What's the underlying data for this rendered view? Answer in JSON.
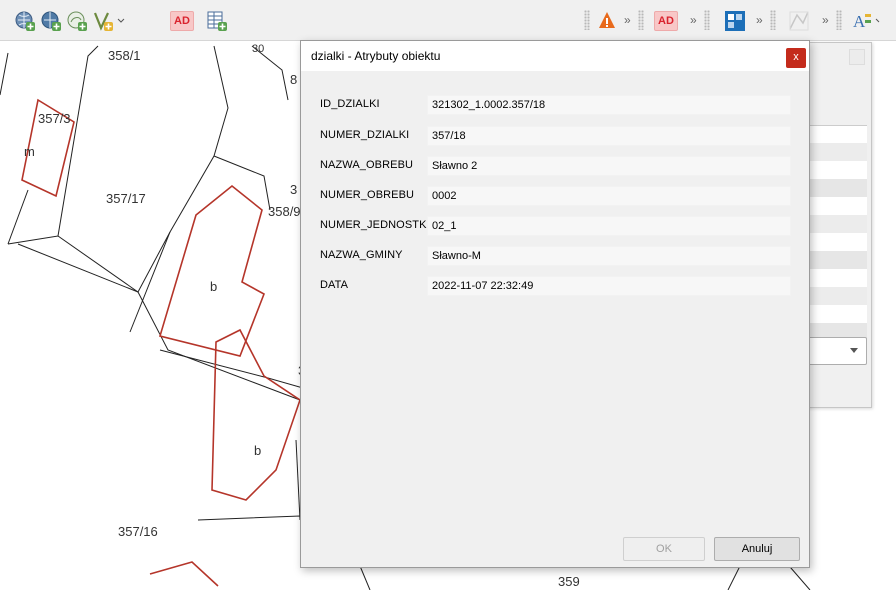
{
  "toolbar": {
    "left_icons": [
      "add-wms-icon",
      "add-wfs-icon",
      "add-wcs-icon",
      "add-vector-layer-icon",
      "ad-plugin-icon",
      "add-table-icon"
    ],
    "right_icons": [
      "fire-plugin-icon",
      "ad-plugin-icon",
      "grid-plugin-icon",
      "digitize-icon",
      "label-icon"
    ],
    "ad_label": "AD",
    "more_chevron": "»"
  },
  "map": {
    "labels": [
      {
        "text": "358/1"
      },
      {
        "text": "357/3"
      },
      {
        "text": "m"
      },
      {
        "text": "357/17"
      },
      {
        "text": "3"
      },
      {
        "text": "358/9"
      },
      {
        "text": "b"
      },
      {
        "text": "b"
      },
      {
        "text": "357/16"
      },
      {
        "text": "359"
      },
      {
        "text": "8"
      },
      {
        "text": "3"
      },
      {
        "text": "30"
      }
    ]
  },
  "dialog": {
    "title": "dzialki - Atrybuty obiektu",
    "close_glyph": "x",
    "fields": [
      {
        "name": "ID_DZIALKI",
        "value": "321302_1.0002.357/18"
      },
      {
        "name": "NUMER_DZIALKI",
        "value": "357/18"
      },
      {
        "name": "NAZWA_OBREBU",
        "value": "Sławno 2"
      },
      {
        "name": "NUMER_OBREBU",
        "value": "0002"
      },
      {
        "name": "NUMER_JEDNOSTKI",
        "value": "02_1"
      },
      {
        "name": "NAZWA_GMINY",
        "value": "Sławno-M"
      },
      {
        "name": "DATA",
        "value": "2022-11-07 22:32:49"
      }
    ],
    "ok_label": "OK",
    "cancel_label": "Anuluj"
  },
  "colors": {
    "parcel_line": "#222222",
    "building_line": "#b5352a",
    "close_button": "#c42b1c"
  }
}
